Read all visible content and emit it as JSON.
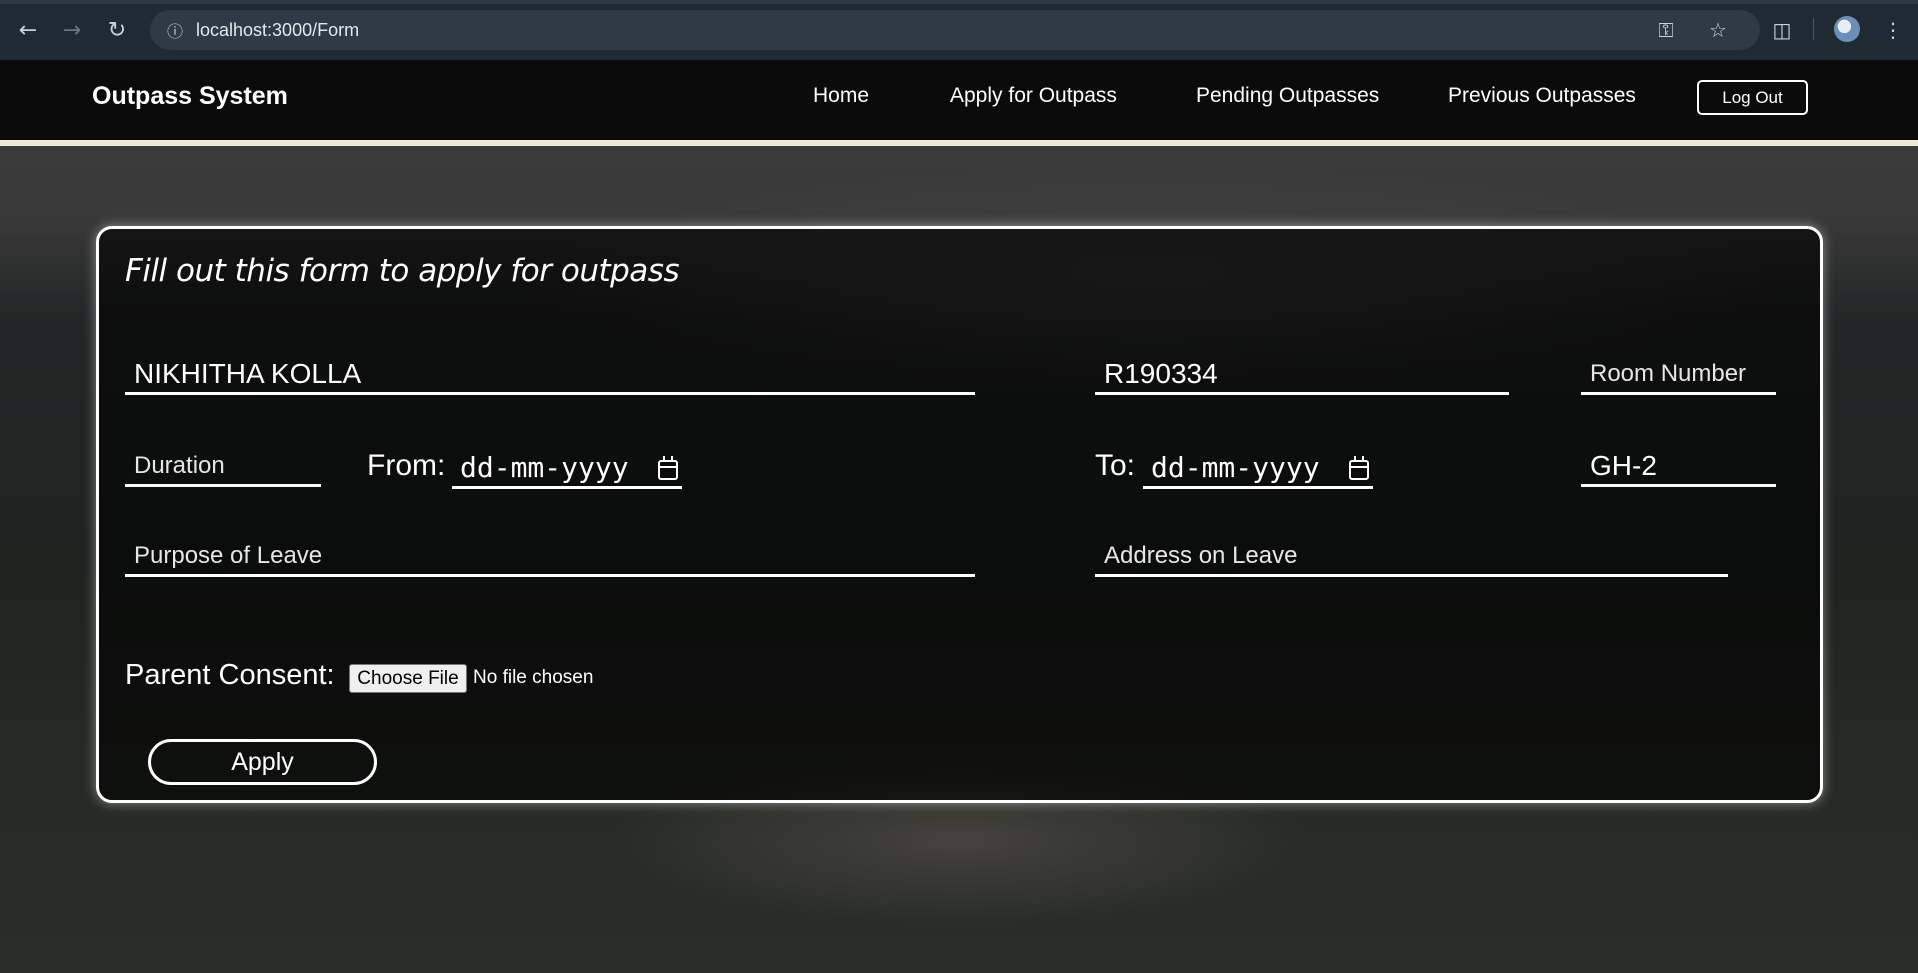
{
  "browser": {
    "url": "localhost:3000/Form",
    "icons": {
      "back": "back-arrow-icon",
      "forward": "forward-arrow-icon",
      "reload": "reload-icon",
      "site_info": "site-info-icon",
      "password": "key-icon",
      "bookmark": "star-icon",
      "extensions": "puzzle-icon",
      "profile": "avatar",
      "menu": "kebab-menu-icon"
    }
  },
  "navbar": {
    "brand": "Outpass System",
    "links": [
      "Home",
      "Apply for Outpass",
      "Pending Outpasses",
      "Previous Outpasses"
    ],
    "logout": "Log Out"
  },
  "form": {
    "title": "Fill out this form to apply for outpass",
    "name_value": "NIKHITHA KOLLA",
    "id_value": "R190334",
    "room_placeholder": "Room Number",
    "duration_placeholder": "Duration",
    "from_label": "From:",
    "from_value": "dd-mm-yyyy",
    "to_label": "To:",
    "to_value": "dd-mm-yyyy",
    "hostel_value": "GH-2",
    "purpose_placeholder": "Purpose of Leave",
    "address_placeholder": "Address on Leave",
    "consent_label": "Parent Consent:",
    "file_button": "Choose File",
    "file_status": "No file chosen",
    "apply_button": "Apply"
  },
  "colors": {
    "navbar_bg": "#0b0b0b",
    "navbar_rule": "#f1ead6",
    "card_border": "#ffffff",
    "text": "#ffffff"
  }
}
